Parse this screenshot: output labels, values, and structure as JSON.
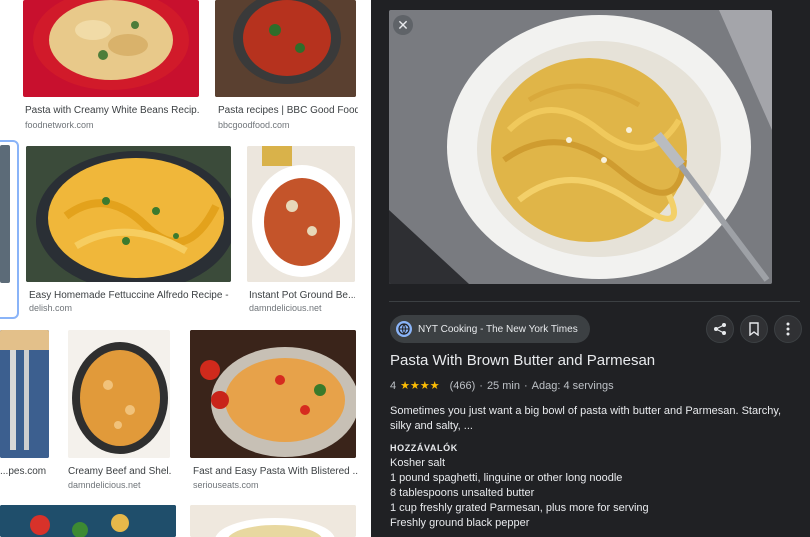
{
  "results": [
    {
      "caption": "Pasta with Creamy White Beans Recip...",
      "source": "foodnetwork.com"
    },
    {
      "caption": "Pasta recipes | BBC Good Food",
      "source": "bbcgoodfood.com"
    },
    {
      "caption": "Easy Homemade Fettuccine Alfredo Recipe -...",
      "source": "delish.com"
    },
    {
      "caption": "Instant Pot Ground Be...",
      "source": "damndelicious.net"
    },
    {
      "caption": "...pes.com",
      "source": ""
    },
    {
      "caption": "Creamy Beef and Shel...",
      "source": "damndelicious.net"
    },
    {
      "caption": "Fast and Easy Pasta With Blistered ...",
      "source": "seriouseats.com"
    }
  ],
  "panel": {
    "source_chip": "NYT Cooking - The New York Times",
    "title": "Pasta With Brown Butter and Parmesan",
    "rating": "4",
    "stars": "★★★★",
    "reviews": "(466)",
    "time": "25 min",
    "servings": "Adag: 4 servings",
    "description": "Sometimes you just want a big bowl of pasta with butter and Parmesan. Starchy, silky and salty, ...",
    "ingredients_heading": "HOZZÁVALÓK",
    "ingredients": [
      "Kosher salt",
      "1 pound spaghetti, linguine or other long noodle",
      "8 tablespoons unsalted butter",
      "1 cup freshly grated Parmesan, plus more for serving",
      "Freshly ground black pepper"
    ],
    "sep": "·",
    "close_glyph": "✕"
  },
  "colors": {
    "panel_bg": "#202124",
    "accent": "#8ab4f8",
    "star": "#fbbc04"
  }
}
